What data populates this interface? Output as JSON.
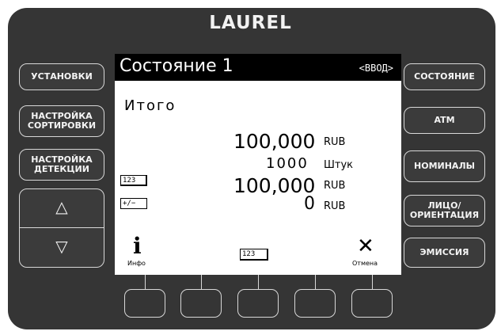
{
  "brand": "LAUREL",
  "left_buttons": [
    {
      "lines": [
        "УСТАНОВКИ"
      ]
    },
    {
      "lines": [
        "НАСТРОЙКА",
        "СОРТИРОВКИ"
      ]
    },
    {
      "lines": [
        "НАСТРОЙКА",
        "ДЕТЕКЦИИ"
      ]
    }
  ],
  "arrows": {
    "up": "△",
    "down": "▽"
  },
  "right_buttons": [
    {
      "lines": [
        "СОСТОЯНИЕ"
      ]
    },
    {
      "lines": [
        "ATM"
      ]
    },
    {
      "lines": [
        "НОМИНАЛЫ"
      ]
    },
    {
      "lines": [
        "ЛИЦО/",
        "ОРИЕНТАЦИЯ"
      ]
    },
    {
      "lines": [
        "ЭМИССИЯ"
      ]
    }
  ],
  "screen": {
    "title": "Состояние 1",
    "input_tag": "<ВВОД>",
    "total_label": "Итого",
    "total_amount": "100,000",
    "total_currency": "RUB",
    "count": "1000",
    "count_unit": "Штук",
    "bundle_icon_label": "123",
    "bundle_amount": "100,000",
    "bundle_currency": "RUB",
    "diff_icon_label": "+/−",
    "diff_amount": "0",
    "diff_currency": "RUB",
    "info_glyph": "i",
    "info_label": "Инфо",
    "center_icon_label": "123",
    "cancel_glyph": "✕",
    "cancel_label": "Отмена"
  }
}
